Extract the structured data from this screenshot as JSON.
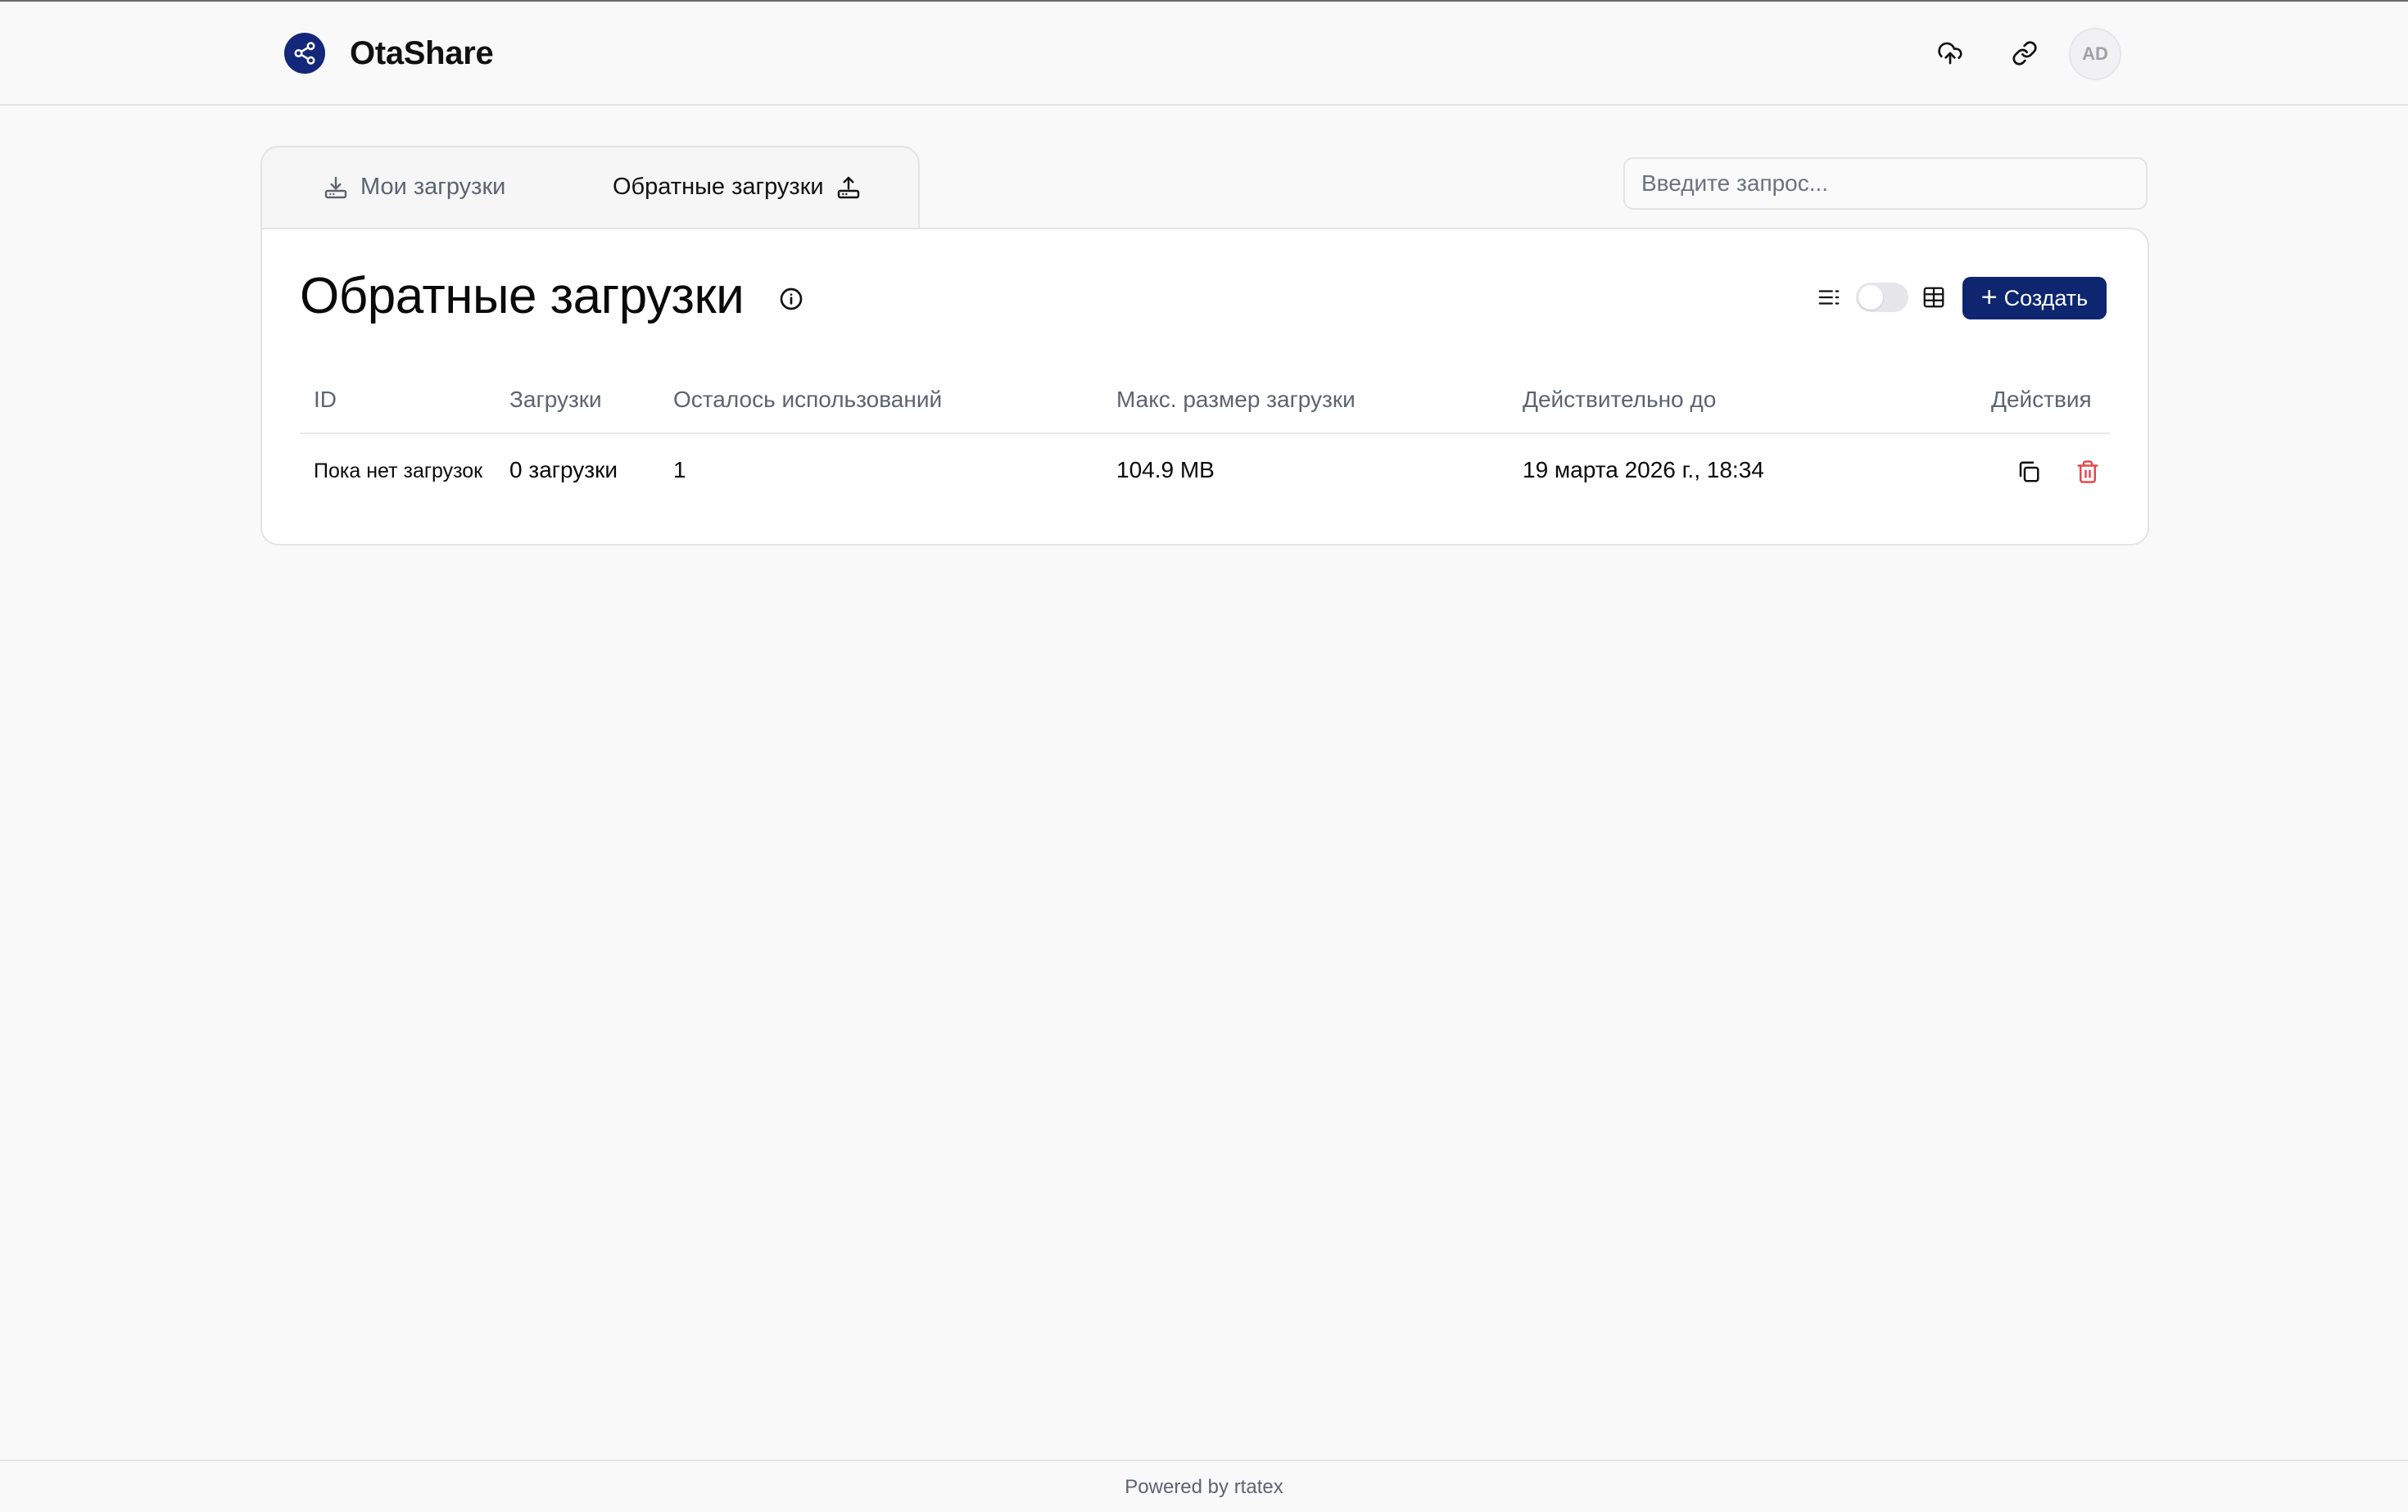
{
  "app": {
    "name": "OtaShare",
    "logo_icon": "share-icon",
    "accent": "#13287a"
  },
  "header": {
    "icons": [
      "cloud-upload-icon",
      "link-icon"
    ],
    "avatar_initials": "AD"
  },
  "tabs": [
    {
      "label": "Мои загрузки",
      "icon": "download-tray-icon",
      "active": false
    },
    {
      "label": "Обратные загрузки",
      "icon": "upload-tray-icon",
      "active": true
    }
  ],
  "search": {
    "placeholder": "Введите запрос...",
    "value": ""
  },
  "main": {
    "title": "Обратные загрузки",
    "create_label": "Создать",
    "view_toggle_on": false
  },
  "table": {
    "columns": [
      "ID",
      "Загрузки",
      "Осталось использований",
      "Макс. размер загрузки",
      "Действительно до",
      "Действия"
    ],
    "rows": [
      {
        "id": "Пока нет загрузок",
        "uploads": "0 загрузки",
        "uses_left": "1",
        "max_size": "104.9 MB",
        "valid_until": "19 марта 2026 г., 18:34",
        "actions": [
          "copy-icon",
          "trash-icon"
        ]
      }
    ]
  },
  "footer": {
    "text": "Powered by rtatex"
  },
  "colors": {
    "primary_button": "#0e2570",
    "danger": "#e5484d",
    "muted_text": "#5c6470"
  }
}
